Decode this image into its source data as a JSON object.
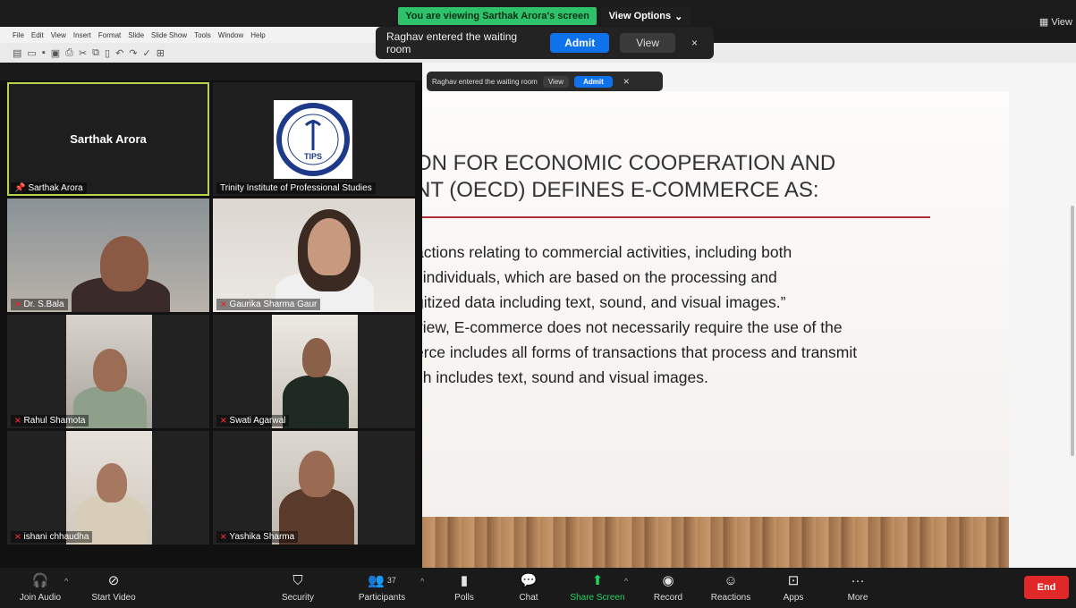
{
  "banner": {
    "share_text": "You are viewing Sarthak Arora's screen",
    "view_options": "View Options",
    "corner_view": "View"
  },
  "office": {
    "menu": [
      "File",
      "Edit",
      "View",
      "Insert",
      "Format",
      "Slide",
      "Slide Show",
      "Tools",
      "Window",
      "Help"
    ]
  },
  "notification": {
    "text": "Raghav entered the waiting room",
    "admit": "Admit",
    "view": "View",
    "close": "×"
  },
  "notification_small": {
    "text": "Raghav entered the waiting room",
    "view": "View",
    "admit": "Admit",
    "close": "×"
  },
  "slide": {
    "title_lines": [
      "ON FOR ECONOMIC COOPERATION AND",
      "NT (OECD) DEFINES E-COMMERCE AS:"
    ],
    "body_lines": [
      "actions relating to commercial activities, including both",
      "l individuals, which are based on the processing and",
      "gitized data including text, sound, and visual images.”",
      "view, E-commerce does not necessarily require the use of the",
      "erce includes all forms of transactions that process and transmit",
      "ch includes text, sound and visual images."
    ]
  },
  "participants": [
    {
      "name": "Sarthak Arora",
      "center": "Sarthak Arora",
      "pinned": true
    },
    {
      "name": "Trinity Institute of Professional Studies",
      "logo_text": "TIPS",
      "logo_ring": "TRINITY INSTITUTE OF PROFESSIONAL STUDIES",
      "logo_motto": "LIGHT TO ENLIGHTEN"
    },
    {
      "name": "Dr. S.Bala",
      "muted": true
    },
    {
      "name": "Gaurika Sharma Gaur",
      "muted": true
    },
    {
      "name": "Rahul Shamota",
      "muted": true
    },
    {
      "name": "Swati Agarwal",
      "muted": true
    },
    {
      "name": "ishani chhaudha",
      "muted": true
    },
    {
      "name": "Yashika Sharma",
      "muted": true
    }
  ],
  "controls": {
    "join_audio": "Join Audio",
    "start_video": "Start Video",
    "security": "Security",
    "participants": "Participants",
    "participants_count": "37",
    "polls": "Polls",
    "chat": "Chat",
    "share_screen": "Share Screen",
    "record": "Record",
    "reactions": "Reactions",
    "apps": "Apps",
    "more": "More",
    "end": "End"
  },
  "colors": {
    "share_green": "#2ec26a",
    "admit_blue": "#0e72ed",
    "end_red": "#e02828",
    "active_speaker": "#b7d44d",
    "slide_rule": "#b02a3a"
  }
}
